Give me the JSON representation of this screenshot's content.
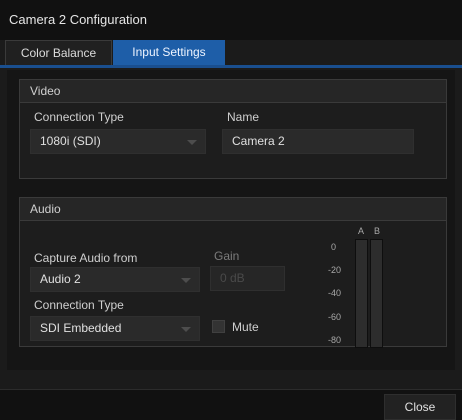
{
  "window": {
    "title": "Camera 2 Configuration"
  },
  "tabs": [
    {
      "label": "Color Balance"
    },
    {
      "label": "Input Settings"
    }
  ],
  "video": {
    "heading": "Video",
    "connection_type_label": "Connection Type",
    "connection_type_value": "1080i (SDI)",
    "name_label": "Name",
    "name_value": "Camera 2"
  },
  "audio": {
    "heading": "Audio",
    "capture_label": "Capture Audio from",
    "capture_value": "Audio 2",
    "gain_label": "Gain",
    "gain_value": "0 dB",
    "connection_type_label": "Connection Type",
    "connection_type_value": "SDI Embedded",
    "mute_label": "Mute",
    "meter": {
      "channels": [
        "A",
        "B"
      ],
      "scale": [
        "0",
        "-20",
        "-40",
        "-60",
        "-80"
      ]
    }
  },
  "footer": {
    "close_label": "Close"
  }
}
